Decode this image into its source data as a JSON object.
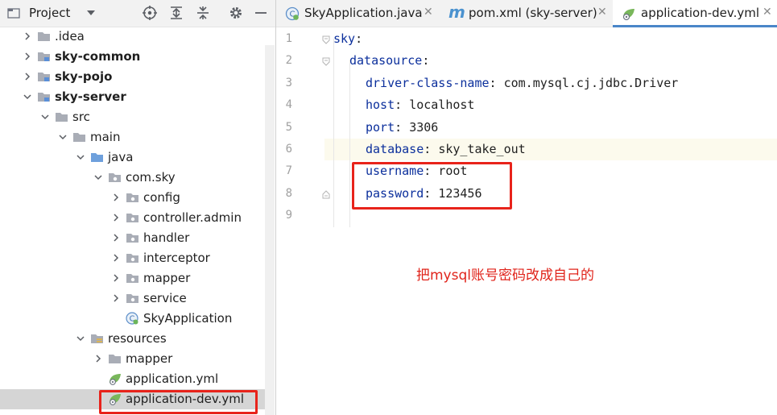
{
  "project": {
    "title": "Project",
    "icons": [
      "dropdown-icon",
      "locate-icon",
      "expand-all-icon",
      "collapse-all-icon",
      "gear-icon",
      "minimize-icon"
    ],
    "tree": [
      {
        "label": ".idea",
        "bold": false,
        "depth": 0,
        "arrow": "right",
        "icon": "folder"
      },
      {
        "label": "sky-common",
        "bold": true,
        "depth": 0,
        "arrow": "right",
        "icon": "module"
      },
      {
        "label": "sky-pojo",
        "bold": true,
        "depth": 0,
        "arrow": "right",
        "icon": "module"
      },
      {
        "label": "sky-server",
        "bold": true,
        "depth": 0,
        "arrow": "down",
        "icon": "module"
      },
      {
        "label": "src",
        "bold": false,
        "depth": 1,
        "arrow": "down",
        "icon": "folder"
      },
      {
        "label": "main",
        "bold": false,
        "depth": 2,
        "arrow": "down",
        "icon": "folder"
      },
      {
        "label": "java",
        "bold": false,
        "depth": 3,
        "arrow": "down",
        "icon": "source-folder"
      },
      {
        "label": "com.sky",
        "bold": false,
        "depth": 4,
        "arrow": "down",
        "icon": "package"
      },
      {
        "label": "config",
        "bold": false,
        "depth": 5,
        "arrow": "right",
        "icon": "package"
      },
      {
        "label": "controller.admin",
        "bold": false,
        "depth": 5,
        "arrow": "right",
        "icon": "package"
      },
      {
        "label": "handler",
        "bold": false,
        "depth": 5,
        "arrow": "right",
        "icon": "package"
      },
      {
        "label": "interceptor",
        "bold": false,
        "depth": 5,
        "arrow": "right",
        "icon": "package"
      },
      {
        "label": "mapper",
        "bold": false,
        "depth": 5,
        "arrow": "right",
        "icon": "package"
      },
      {
        "label": "service",
        "bold": false,
        "depth": 5,
        "arrow": "right",
        "icon": "package"
      },
      {
        "label": "SkyApplication",
        "bold": false,
        "depth": 5,
        "arrow": "none",
        "icon": "spring-class"
      },
      {
        "label": "resources",
        "bold": false,
        "depth": 3,
        "arrow": "down",
        "icon": "resources-folder"
      },
      {
        "label": "mapper",
        "bold": false,
        "depth": 4,
        "arrow": "right",
        "icon": "folder"
      },
      {
        "label": "application.yml",
        "bold": false,
        "depth": 4,
        "arrow": "none",
        "icon": "yaml-file"
      },
      {
        "label": "application-dev.yml",
        "bold": false,
        "depth": 4,
        "arrow": "none",
        "icon": "yaml-file",
        "selected": true
      }
    ]
  },
  "tabs": [
    {
      "label": "SkyApplication.java",
      "icon": "spring-class-icon",
      "active": false,
      "closable": true
    },
    {
      "label": "pom.xml (sky-server)",
      "icon": "maven-icon",
      "active": false,
      "closable": true
    },
    {
      "label": "application-dev.yml",
      "icon": "yaml-file-icon",
      "active": true,
      "closable": true
    }
  ],
  "editor": {
    "current_line": 6,
    "lines": [
      {
        "n": "1",
        "indent": 0,
        "key": "sky",
        "sep": ":",
        "value": ""
      },
      {
        "n": "2",
        "indent": 1,
        "key": "datasource",
        "sep": ":",
        "value": ""
      },
      {
        "n": "3",
        "indent": 2,
        "key": "driver-class-name",
        "sep": ": ",
        "value": "com.mysql.cj.jdbc.Driver"
      },
      {
        "n": "4",
        "indent": 2,
        "key": "host",
        "sep": ": ",
        "value": "localhost"
      },
      {
        "n": "5",
        "indent": 2,
        "key": "port",
        "sep": ": ",
        "value": "3306"
      },
      {
        "n": "6",
        "indent": 2,
        "key": "database",
        "sep": ": ",
        "value": "sky_take_out"
      },
      {
        "n": "7",
        "indent": 2,
        "key": "username",
        "sep": ": ",
        "value": "root"
      },
      {
        "n": "8",
        "indent": 2,
        "key": "password",
        "sep": ": ",
        "value": "123456"
      },
      {
        "n": "9",
        "indent": 0,
        "key": "",
        "sep": "",
        "value": ""
      }
    ]
  },
  "annotation": {
    "text": "把mysql账号密码改成自己的",
    "color": "#e0241b"
  },
  "colors": {
    "yaml_key": "#0b2f9c",
    "highlight_box": "#e8231b",
    "selected_row": "#d5d5d5"
  }
}
